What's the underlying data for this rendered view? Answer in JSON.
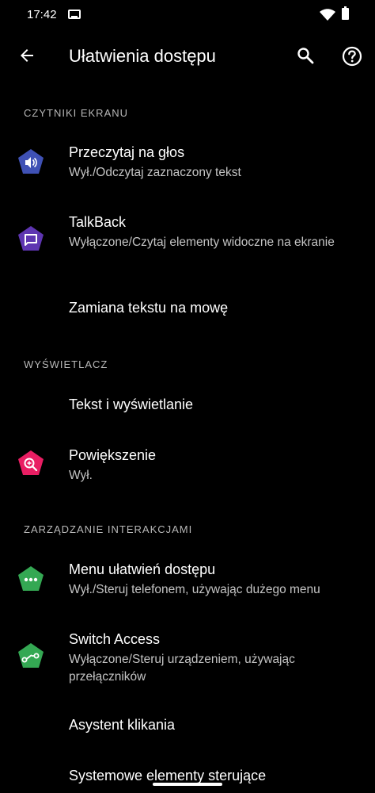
{
  "status_bar": {
    "time": "17:42"
  },
  "app_bar": {
    "title": "Ułatwienia dostępu"
  },
  "sections": {
    "screen_readers": "CZYTNIKI EKRANU",
    "display": "WYŚWIETLACZ",
    "interaction": "ZARZĄDZANIE INTERAKCJAMI"
  },
  "items": {
    "read_aloud": {
      "title": "Przeczytaj na głos",
      "subtitle": "Wył./Odczytaj zaznaczony tekst",
      "icon": "speaker-icon",
      "color": "#3f51b5"
    },
    "talkback": {
      "title": "TalkBack",
      "subtitle": "Wyłączone/Czytaj elementy widoczne na ekranie",
      "icon": "speech-bubble-icon",
      "color": "#5e35b1"
    },
    "tts": {
      "title": "Zamiana tekstu na mowę"
    },
    "text_display": {
      "title": "Tekst i wyświetlanie"
    },
    "magnification": {
      "title": "Powiększenie",
      "subtitle": "Wył.",
      "icon": "magnifier-icon",
      "color": "#e91e63"
    },
    "a11y_menu": {
      "title": "Menu ułatwień dostępu",
      "subtitle": "Wył./Steruj telefonem, używając dużego menu",
      "icon": "dots-menu-icon",
      "color": "#34a853"
    },
    "switch_access": {
      "title": "Switch Access",
      "subtitle": "Wyłączone/Steruj urządzeniem, używając przełączników",
      "icon": "switch-icon",
      "color": "#34a853"
    },
    "click_assistant": {
      "title": "Asystent klikania"
    },
    "system_controls": {
      "title": "Systemowe elementy sterujące"
    }
  }
}
